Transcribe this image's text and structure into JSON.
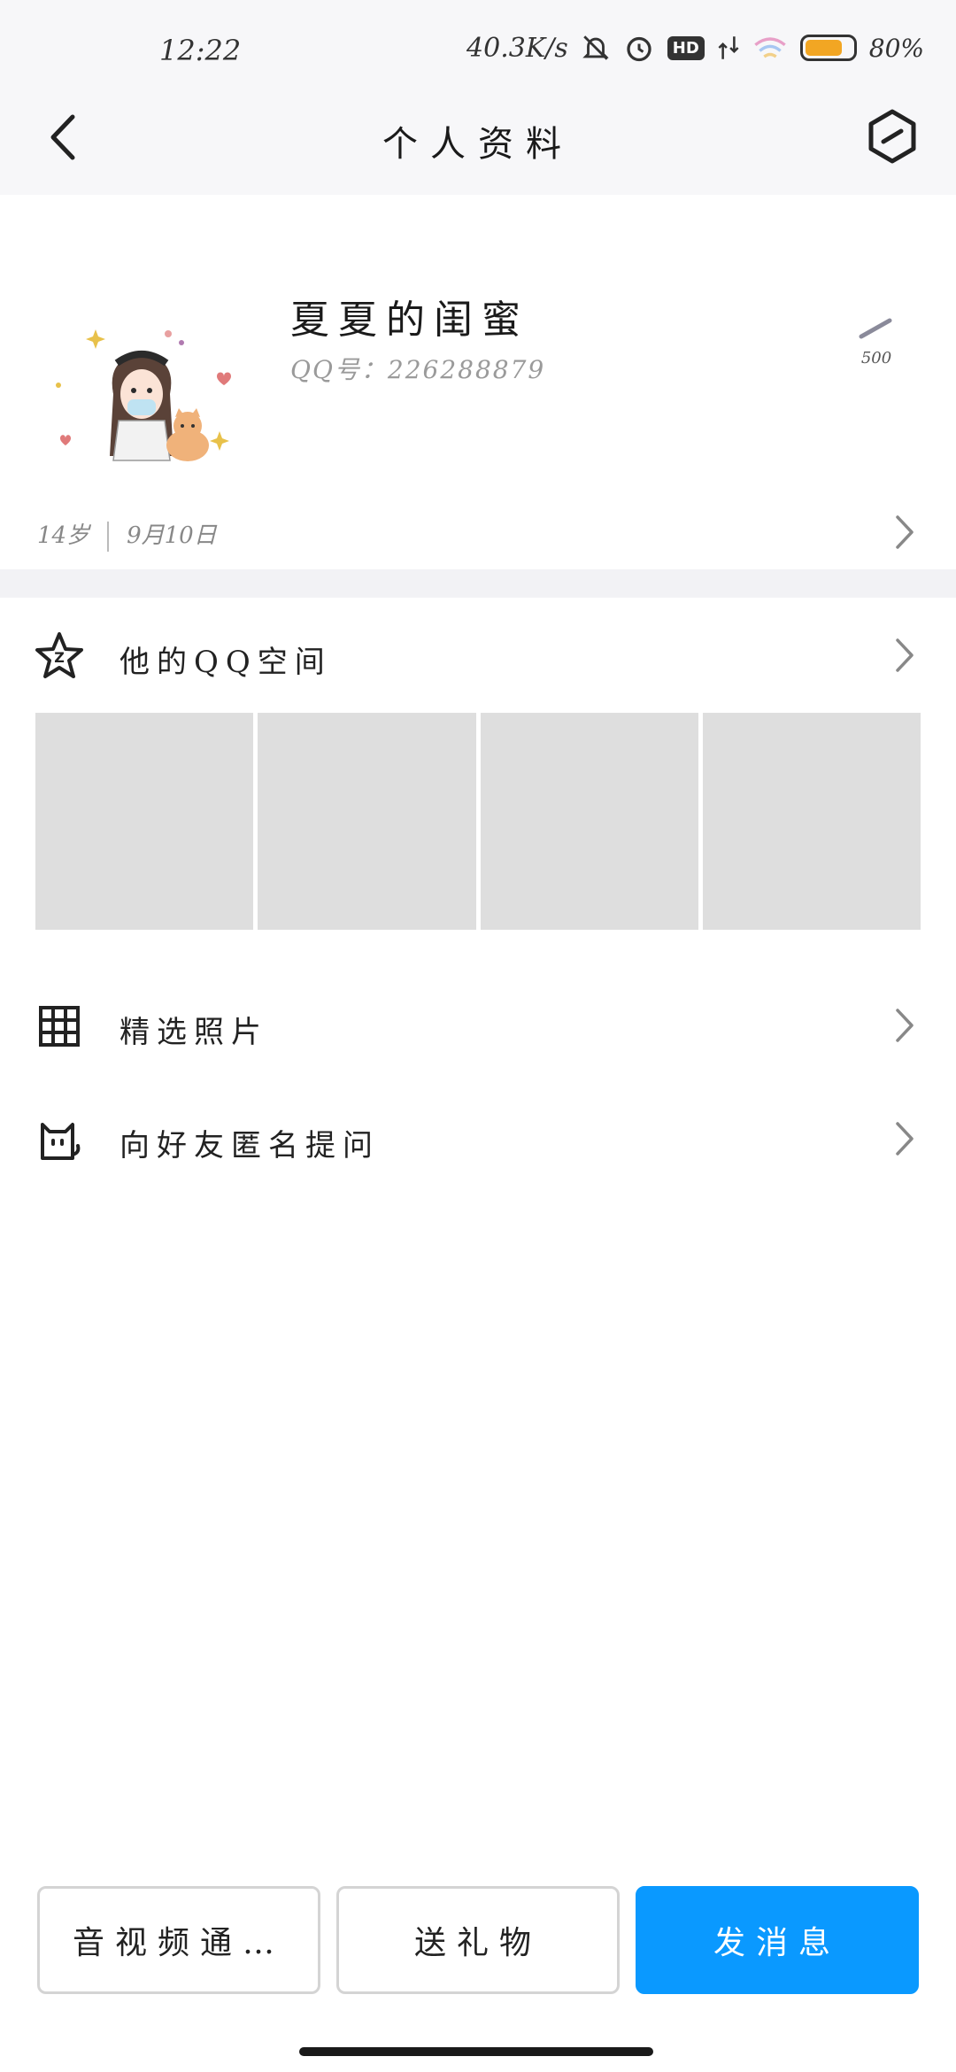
{
  "status_bar": {
    "time": "12:22",
    "network_speed": "40.3K/s",
    "hd_label": "HD",
    "battery_level": 0.8,
    "battery_text": "80%",
    "icons": [
      "mute-bell-icon",
      "alarm-icon",
      "hd-icon",
      "signal-4g-icon",
      "wifi-icon",
      "battery-icon"
    ]
  },
  "header": {
    "title": "个人资料",
    "back_icon": "back-arrow-icon",
    "settings_icon": "hexagon-settings-icon"
  },
  "profile": {
    "nickname": "夏夏的闺蜜",
    "qq_number": "QQ号：226288879",
    "likes_count": "500",
    "age": "14岁",
    "birthday": "9月10日"
  },
  "sections": {
    "qzone_label": "他的QQ空间",
    "qzone_photos_count": 4,
    "featured_photos_label": "精选照片",
    "anonymous_question_label": "向好友匿名提问"
  },
  "actions": {
    "video_call": "音视频通…",
    "send_gift": "送礼物",
    "send_message": "发消息"
  },
  "colors": {
    "primary": "#0a99ff",
    "background_alt": "#f7f7f9",
    "divider": "#f2f2f5",
    "photo_placeholder": "#dedede",
    "battery": "#f2a623"
  }
}
